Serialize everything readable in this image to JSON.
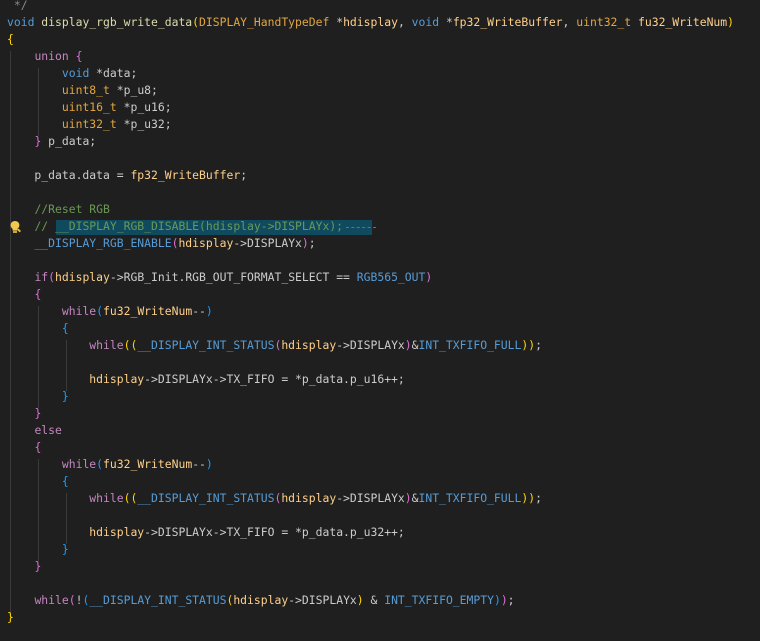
{
  "editor": {
    "lines": [
      " */",
      "void display_rgb_write_data(DISPLAY_HandTypeDef *hdisplay, void *fp32_WriteBuffer, uint32_t fu32_WriteNum)",
      "{",
      "    union {",
      "        void *data;",
      "        uint8_t *p_u8;",
      "        uint16_t *p_u16;",
      "        uint32_t *p_u32;",
      "    } p_data;",
      "",
      "    p_data.data = fp32_WriteBuffer;",
      "",
      "    //Reset RGB",
      "    // __DISPLAY_RGB_DISABLE(hdisplay->DISPLAYx);",
      "    __DISPLAY_RGB_ENABLE(hdisplay->DISPLAYx);",
      "",
      "    if(hdisplay->RGB_Init.RGB_OUT_FORMAT_SELECT == RGB565_OUT)",
      "    {",
      "        while(fu32_WriteNum--)",
      "        {",
      "            while((__DISPLAY_INT_STATUS(hdisplay->DISPLAYx)&INT_TXFIFO_FULL));",
      "",
      "            hdisplay->DISPLAYx->TX_FIFO = *p_data.p_u16++;",
      "        }",
      "    }",
      "    else",
      "    {",
      "        while(fu32_WriteNum--)",
      "        {",
      "            while((__DISPLAY_INT_STATUS(hdisplay->DISPLAYx)&INT_TXFIFO_FULL));",
      "",
      "            hdisplay->DISPLAYx->TX_FIFO = *p_data.p_u32++;",
      "        }",
      "    }",
      "",
      "    while(!(__DISPLAY_INT_STATUS(hdisplay->DISPLAYx) & INT_TXFIFO_EMPTY));",
      "}"
    ]
  },
  "lightbulb_icon": "lightbulb-icon",
  "colors": {
    "background": "#1f1f1f",
    "keyword": "#c586c0",
    "type_keyword": "#569cd6",
    "type": "#e2a53e",
    "function": "#dcdcaa",
    "parameter": "#ffd08a",
    "macro": "#569cd6",
    "comment": "#6a9955",
    "selection": "#0f4a5e"
  }
}
